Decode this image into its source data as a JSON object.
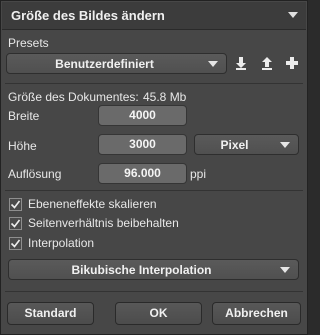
{
  "dialog": {
    "title": "Größe des Bildes ändern"
  },
  "presets": {
    "label": "Presets",
    "selected": "Benutzerdefiniert"
  },
  "document": {
    "size_label": "Größe des Dokumentes:",
    "size_value": "45.8 Mb"
  },
  "dimensions": {
    "width_label": "Breite",
    "width_value": "4000",
    "height_label": "Höhe",
    "height_value": "3000",
    "unit": "Pixel",
    "resolution_label": "Auflösung",
    "resolution_value": "96.000",
    "resolution_unit": "ppi"
  },
  "options": {
    "scale_effects": "Ebeneneffekte skalieren",
    "keep_ratio": "Seitenverhältnis beibehalten",
    "interpolation": "Interpolation",
    "interpolation_method": "Bikubische Interpolation"
  },
  "buttons": {
    "standard": "Standard",
    "ok": "OK",
    "cancel": "Abbrechen"
  },
  "icons": {
    "download": "download-icon",
    "upload": "upload-icon",
    "add": "plus-icon"
  }
}
